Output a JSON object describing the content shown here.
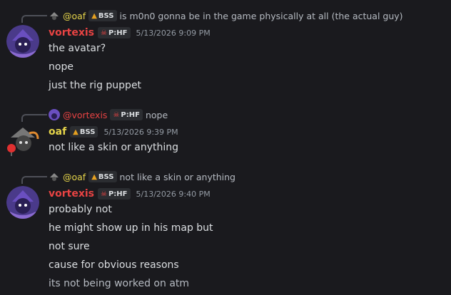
{
  "messages": [
    {
      "reply": {
        "author": "@oaf",
        "tag": "BSS",
        "text": "is m0n0 gonna be in the game physically at all (the actual guy)"
      },
      "author": "vortexis",
      "tag": "P:HF",
      "timestamp": "5/13/2026 9:09 PM",
      "lines": [
        "the avatar?",
        "nope",
        "just the rig puppet"
      ]
    },
    {
      "reply": {
        "author": "@vortexis",
        "tag": "P:HF",
        "text": "nope"
      },
      "author": "oaf",
      "tag": "BSS",
      "timestamp": "5/13/2026 9:39 PM",
      "lines": [
        "not like a skin or anything"
      ]
    },
    {
      "reply": {
        "author": "@oaf",
        "tag": "BSS",
        "text": "not like a skin or anything"
      },
      "author": "vortexis",
      "tag": "P:HF",
      "timestamp": "5/13/2026 9:40 PM",
      "lines": [
        "probably not",
        "he might show up in his map but",
        "not sure",
        "cause for obvious reasons",
        "its not being worked on atm"
      ]
    }
  ],
  "colors": {
    "vortexis": "#e84343",
    "oaf": "#e5d44a",
    "background": "#1a1a1e"
  }
}
